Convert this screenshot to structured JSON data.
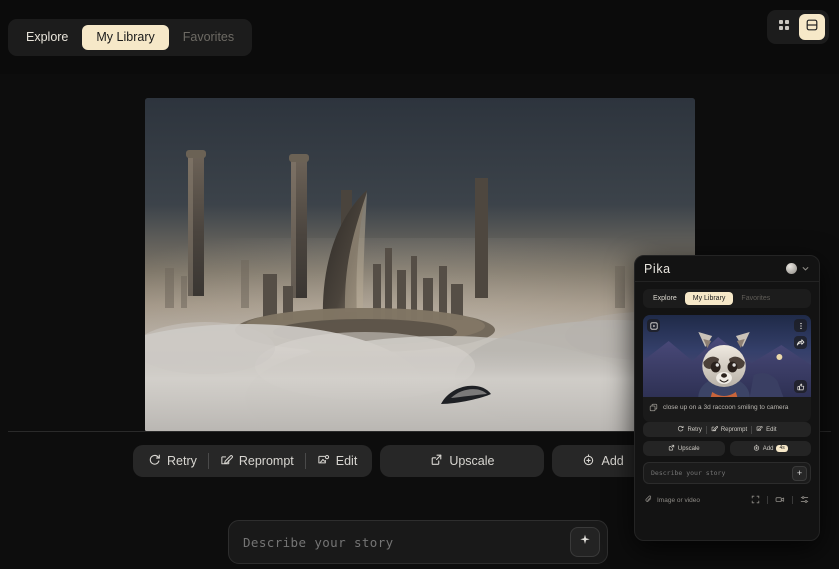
{
  "header": {
    "tabs": [
      {
        "label": "Explore",
        "state": "normal"
      },
      {
        "label": "My Library",
        "state": "active"
      },
      {
        "label": "Favorites",
        "state": "dim"
      }
    ],
    "view_modes": [
      {
        "name": "grid-view",
        "state": "normal"
      },
      {
        "name": "list-view",
        "state": "active"
      }
    ]
  },
  "main": {
    "image_alt": "futuristic city skyline above clouds",
    "actions": {
      "retry": "Retry",
      "reprompt": "Reprompt",
      "edit": "Edit",
      "upscale": "Upscale",
      "add": "Add"
    },
    "prompt": {
      "value": "",
      "placeholder": "Describe your story"
    }
  },
  "panel": {
    "logo": "Pika",
    "tabs": [
      {
        "label": "Explore",
        "state": "normal"
      },
      {
        "label": "My Library",
        "state": "active"
      },
      {
        "label": "Favorites",
        "state": "dim"
      }
    ],
    "card": {
      "caption": "close up on a 3d raccoon smiling to camera",
      "image_alt": "3d raccoon character smiling at camera"
    },
    "actions": {
      "retry": "Retry",
      "reprompt": "Reprompt",
      "edit": "Edit",
      "upscale": "Upscale",
      "add": "Add",
      "add_badge": "4s"
    },
    "prompt": {
      "value": "",
      "placeholder": "Describe your story"
    },
    "footer": {
      "attach_label": "Image or video"
    }
  },
  "colors": {
    "accent_cream": "#f6e8c8",
    "background": "#0d0d0d",
    "surface": "#1c1c1c",
    "pill": "#272727"
  }
}
